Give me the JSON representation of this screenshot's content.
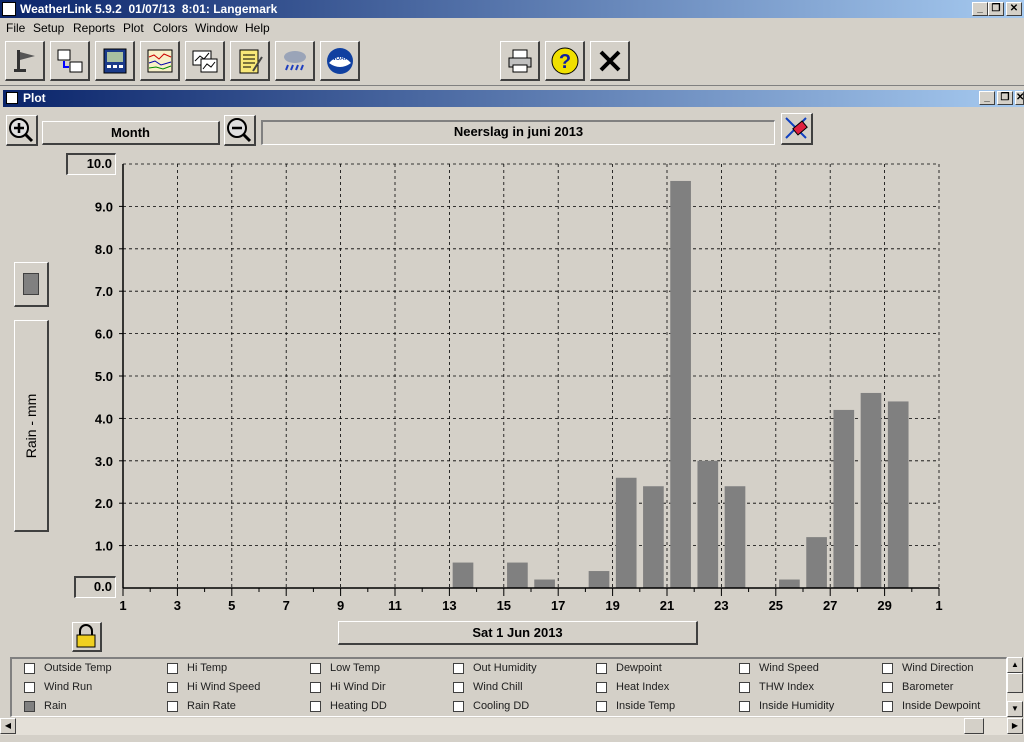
{
  "app": {
    "title": "WeatherLink 5.9.2  01/07/13  8:01: Langemark"
  },
  "window_controls": {
    "minimize": "_",
    "restore": "❐",
    "close": "✕"
  },
  "menu": [
    "File",
    "Setup",
    "Reports",
    "Plot",
    "Colors",
    "Window",
    "Help"
  ],
  "toolbar": {
    "icons": [
      "bulletin-icon",
      "download-icon",
      "console-icon",
      "strip-chart-icon",
      "plot-icon",
      "notes-icon",
      "rain-weather-icon",
      "noaa-icon",
      "print-icon",
      "help-icon",
      "close-icon"
    ],
    "noaa_text": "NOAA",
    "help_glyph": "?",
    "close_glyph": "✕"
  },
  "plot_window": {
    "title": "Plot",
    "period": "Month",
    "chart_title": "Neerslag in juni 2013",
    "y_label": "Rain - mm",
    "y_max_box": "10.0",
    "y_min_box": "0.0",
    "date_label": "Sat 1 Jun 2013"
  },
  "chart_data": {
    "type": "bar",
    "title": "Neerslag in juni 2013",
    "ylabel": "Rain - mm",
    "ylim": [
      0,
      10
    ],
    "yticks": [
      "1.0",
      "2.0",
      "3.0",
      "4.0",
      "5.0",
      "6.0",
      "7.0",
      "8.0",
      "9.0"
    ],
    "xticks": [
      "1",
      "3",
      "5",
      "7",
      "9",
      "11",
      "13",
      "15",
      "17",
      "19",
      "21",
      "23",
      "25",
      "27",
      "29",
      "1"
    ],
    "days": [
      1,
      2,
      3,
      4,
      5,
      6,
      7,
      8,
      9,
      10,
      11,
      12,
      13,
      14,
      15,
      16,
      17,
      18,
      19,
      20,
      21,
      22,
      23,
      24,
      25,
      26,
      27,
      28,
      29,
      30
    ],
    "values": [
      0,
      0,
      0,
      0,
      0,
      0,
      0,
      0,
      0,
      0,
      0,
      0,
      0.6,
      0,
      0.6,
      0.2,
      0,
      0.4,
      2.6,
      2.4,
      9.6,
      3.0,
      2.4,
      0,
      0.2,
      1.2,
      4.2,
      4.6,
      4.4,
      0
    ],
    "bar_color": "#808080",
    "grid": true
  },
  "legend": {
    "items": [
      {
        "label": "Outside Temp",
        "checked": false
      },
      {
        "label": "Hi Temp",
        "checked": false
      },
      {
        "label": "Low Temp",
        "checked": false
      },
      {
        "label": "Out Humidity",
        "checked": false
      },
      {
        "label": "Dewpoint",
        "checked": false
      },
      {
        "label": "Wind Speed",
        "checked": false
      },
      {
        "label": "Wind Direction",
        "checked": false
      },
      {
        "label": "Wind Run",
        "checked": false
      },
      {
        "label": "Hi Wind Speed",
        "checked": false
      },
      {
        "label": "Hi Wind Dir",
        "checked": false
      },
      {
        "label": "Wind Chill",
        "checked": false
      },
      {
        "label": "Heat Index",
        "checked": false
      },
      {
        "label": "THW Index",
        "checked": false
      },
      {
        "label": "Barometer",
        "checked": false
      },
      {
        "label": "Rain",
        "checked": true
      },
      {
        "label": "Rain Rate",
        "checked": false
      },
      {
        "label": "Heating DD",
        "checked": false
      },
      {
        "label": "Cooling DD",
        "checked": false
      },
      {
        "label": "Inside Temp",
        "checked": false
      },
      {
        "label": "Inside Humidity",
        "checked": false
      },
      {
        "label": "Inside Dewpoint",
        "checked": false
      }
    ]
  }
}
